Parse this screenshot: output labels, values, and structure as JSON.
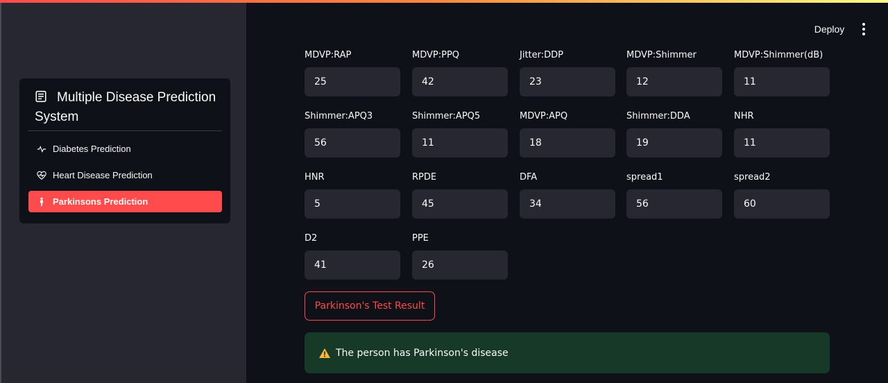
{
  "sidebar": {
    "title": "Multiple Disease Prediction System",
    "items": [
      {
        "label": "Diabetes Prediction",
        "icon": "activity-icon"
      },
      {
        "label": "Heart Disease Prediction",
        "icon": "heart-pulse-icon"
      },
      {
        "label": "Parkinsons Prediction",
        "icon": "person-icon",
        "active": true
      }
    ]
  },
  "header": {
    "deploy_label": "Deploy"
  },
  "fields": [
    {
      "label": "MDVP:RAP",
      "value": "25"
    },
    {
      "label": "MDVP:PPQ",
      "value": "42"
    },
    {
      "label": "Jitter:DDP",
      "value": "23"
    },
    {
      "label": "MDVP:Shimmer",
      "value": "12"
    },
    {
      "label": "MDVP:Shimmer(dB)",
      "value": "11"
    },
    {
      "label": "Shimmer:APQ3",
      "value": "56"
    },
    {
      "label": "Shimmer:APQ5",
      "value": "11"
    },
    {
      "label": "MDVP:APQ",
      "value": "18"
    },
    {
      "label": "Shimmer:DDA",
      "value": "19"
    },
    {
      "label": "NHR",
      "value": "11"
    },
    {
      "label": "HNR",
      "value": "5"
    },
    {
      "label": "RPDE",
      "value": "45"
    },
    {
      "label": "DFA",
      "value": "34"
    },
    {
      "label": "spread1",
      "value": "56"
    },
    {
      "label": "spread2",
      "value": "60"
    },
    {
      "label": "D2",
      "value": "41"
    },
    {
      "label": "PPE",
      "value": "26"
    }
  ],
  "result_button_label": "Parkinson's Test Result",
  "alert": {
    "text": "The person has Parkinson's disease",
    "icon": "warning-icon"
  },
  "colors": {
    "accent": "#ff4b4b",
    "background": "#0e1117",
    "sidebar": "#262730",
    "input": "#262730",
    "alert_bg": "#173928"
  }
}
